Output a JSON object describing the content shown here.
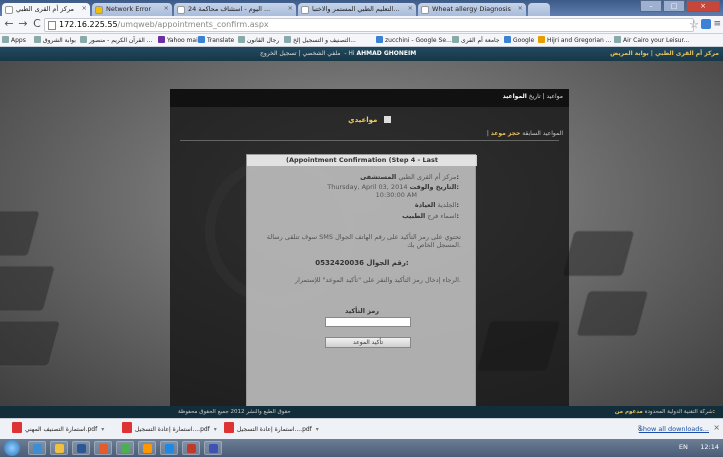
{
  "browser": {
    "tabs": [
      {
        "title": "مركز أم القرى الطبي",
        "active": true
      },
      {
        "title": "Network Error",
        "active": false
      },
      {
        "title": "اليوم - استئناف محاكمة 24 ...",
        "active": false
      },
      {
        "title": "التعليم الطبي المستمر والاختبا...",
        "active": false
      },
      {
        "title": "Wheat allergy Diagnosis",
        "active": false
      }
    ],
    "url_host": "172.16.225.55",
    "url_path": "/umqweb/appointments_confirm.aspx",
    "bookmarks": [
      "Apps",
      "بوابة الشروق",
      "القرآن الكريم - منصور ...",
      "Yahoo mail",
      "Translate",
      "رجال القانون",
      "التصنيف و التسجيل إلخ...",
      "zucchini - Google Se...",
      "جامعة أم القرى",
      "Google",
      "Hijri and Gregorian ...",
      "Air Cairo your Leisur..."
    ]
  },
  "site": {
    "brand": "مركز أم القرى الطبي | بوابة المريض",
    "user_greeting": "Hi",
    "user_name": "AHMAD GHONEIM",
    "user_links": "ملفي الشخصي | تسجيل الخروج"
  },
  "panel": {
    "top_links": "مواعيد | تاريخ",
    "top_active": "المواعيد",
    "section_title": "مواعيدي",
    "subnav_active": "حجز موعد",
    "subnav_other": "| المواعيد السابقة"
  },
  "dialog": {
    "title": "(Appointment Confirmation (Step 4 - Last",
    "hospital_label": "المستشفى:",
    "hospital_value": "مركز أم القرى الطبي",
    "datetime_label": "التاريخ والوقت:",
    "date_value": "Thursday, April 03, 2014",
    "time_value": "10:30:00 AM",
    "clinic_label": "العيادة:",
    "clinic_value": "الجلدية",
    "doctor_label": "الطبيب:",
    "doctor_value": "اسماء فرج",
    "sms_note": "سوف تتلقى رسالة SMS تحتوي على رمز التأكيد على رقم الهاتف الجوال المسجل الخاص بك.",
    "mobile_label": "رقم الجوال:",
    "mobile_value": "0532420036",
    "enter_code_note": "الرجاء إدخال رمز التأكيد والنقر على \"تأكيد الموعد\" للإستمرار.",
    "code_label": "رمز التأكيد",
    "code_value": "",
    "confirm_label": "تأكيد الموعد"
  },
  "footer": {
    "left": "حقوق الطبع والنشر 2012 جميع الحقوق محفوظة",
    "right_label": "مدعوم من:",
    "right_value": "شركة التقنية الدولية المحدودة"
  },
  "downloads": {
    "items": [
      "استمارة التصنيف المهني.pdf",
      "استمارة إعادة التسجيل....pdf",
      "استمارة إعادة التسجيل....pdf"
    ],
    "show_all": "Show all downloads..."
  },
  "taskbar": {
    "lang": "EN",
    "time": "12:14"
  }
}
